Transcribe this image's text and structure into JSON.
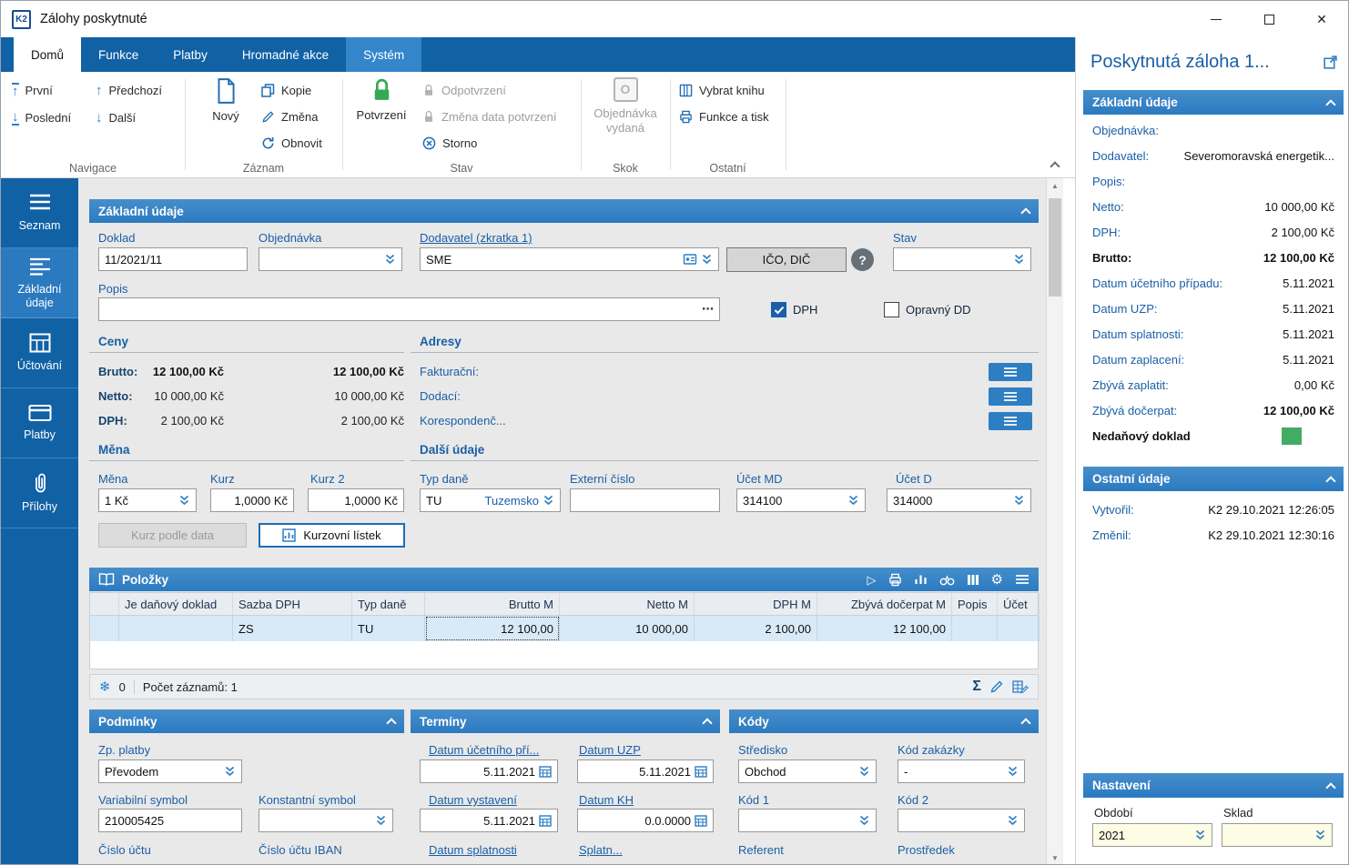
{
  "icons": {
    "close": "✕",
    "more": "⋯",
    "help": "?",
    "arrow_up": "↑",
    "arrow_down": "↓",
    "order_letter": "O",
    "play": "▷",
    "gear": "⚙",
    "snowflake": "❄",
    "sigma": "Σ",
    "scroll_up": "▲",
    "scroll_down": "▼"
  },
  "window": {
    "title": "Zálohy poskytnuté",
    "logo": "K2"
  },
  "ribbon": {
    "tabs": [
      "Domů",
      "Funkce",
      "Platby",
      "Hromadné akce",
      "Systém"
    ],
    "navigace": {
      "group": "Navigace",
      "first": "První",
      "previous": "Předchozí",
      "last": "Poslední",
      "next": "Další"
    },
    "zaznam": {
      "group": "Záznam",
      "new": "Nový",
      "copy": "Kopie",
      "change": "Změna",
      "refresh": "Obnovit"
    },
    "stav": {
      "group": "Stav",
      "confirm": "Potvrzení",
      "unconfirm": "Odpotvrzení",
      "change_confirm_date": "Změna data potvrzení",
      "cancel": "Storno"
    },
    "skok": {
      "group": "Skok",
      "order_issued": "Objednávka vydaná"
    },
    "ostatni": {
      "group": "Ostatní",
      "select_book": "Vybrat knihu",
      "functions_print": "Funkce a tisk"
    }
  },
  "sidebar": {
    "items": [
      "Seznam",
      "Základní údaje",
      "Účtování",
      "Platby",
      "Přílohy"
    ]
  },
  "form": {
    "section_title": "Základní údaje",
    "doklad": {
      "label": "Doklad",
      "value": "11/2021/11"
    },
    "objednavka": {
      "label": "Objednávka",
      "value": ""
    },
    "dodavatel": {
      "label": "Dodavatel (zkratka 1)",
      "value": "SME"
    },
    "ico_dic_button": "IČO, DIČ",
    "stav": {
      "label": "Stav",
      "value": ""
    },
    "popis": {
      "label": "Popis",
      "value": ""
    },
    "dph_checkbox": "DPH",
    "opravny_dd_checkbox": "Opravný DD",
    "ceny": {
      "title": "Ceny",
      "rows": [
        {
          "label": "Brutto:",
          "value1": "12 100,00 Kč",
          "value2": "12 100,00 Kč"
        },
        {
          "label": "Netto:",
          "value1": "10 000,00 Kč",
          "value2": "10 000,00 Kč"
        },
        {
          "label": "DPH:",
          "value1": "2 100,00 Kč",
          "value2": "2 100,00 Kč"
        }
      ]
    },
    "adresy": {
      "title": "Adresy",
      "rows": [
        "Fakturační:",
        "Dodací:",
        "Korespondenč..."
      ]
    },
    "mena": {
      "title": "Měna",
      "mena": {
        "label": "Měna",
        "value": "1 Kč"
      },
      "kurz": {
        "label": "Kurz",
        "value": "1,0000 Kč"
      },
      "kurz2": {
        "label": "Kurz 2",
        "value": "1,0000 Kč"
      }
    },
    "dalsi_udaje": {
      "title": "Další údaje",
      "typ_dane": {
        "label": "Typ daně",
        "code": "TU",
        "value": "Tuzemsko"
      },
      "externi_cislo": {
        "label": "Externí číslo",
        "value": ""
      },
      "ucet_md": {
        "label": "Účet MD",
        "value": "314100"
      },
      "ucet_d": {
        "label": "Účet D",
        "value": "314000"
      }
    },
    "kurz_podle_data_button": "Kurz podle data",
    "kurzovni_listek_button": "Kurzovní lístek"
  },
  "polozky": {
    "title": "Položky",
    "columns": [
      "Je daňový doklad",
      "Sazba DPH",
      "Typ daně",
      "Brutto M",
      "Netto M",
      "DPH M",
      "Zbývá dočerpat M",
      "Popis",
      "Účet"
    ],
    "row": {
      "je_danovy": "",
      "sazba_dph": "ZS",
      "typ_dane": "TU",
      "brutto_m": "12 100,00",
      "netto_m": "10 000,00",
      "dph_m": "2 100,00",
      "zbyva_docerpat_m": "12 100,00",
      "popis": "",
      "ucet": ""
    },
    "frozen": "0",
    "count": "Počet záznamů: 1"
  },
  "podminky": {
    "title": "Podmínky",
    "zp_platby": {
      "label": "Zp. platby",
      "value": "Převodem"
    },
    "variabilni_symbol": {
      "label": "Variabilní symbol",
      "value": "210005425"
    },
    "konstantni_symbol": {
      "label": "Konstantní symbol",
      "value": ""
    },
    "cislo_uctu": "Číslo účtu",
    "cislo_uctu_iban": "Číslo účtu IBAN"
  },
  "terminy": {
    "title": "Termíny",
    "datum_ucetniho": {
      "label": "Datum účetního pří...",
      "value": "5.11.2021"
    },
    "datum_uzp": {
      "label": "Datum UZP",
      "value": "5.11.2021"
    },
    "datum_vystaveni": {
      "label": "Datum vystavení",
      "value": "5.11.2021"
    },
    "datum_kh": {
      "label": "Datum KH",
      "value": "0.0.0000"
    },
    "datum_splatnosti": "Datum splatnosti",
    "splatn": "Splatn..."
  },
  "kody": {
    "title": "Kódy",
    "stredisko": {
      "label": "Středisko",
      "value": "Obchod"
    },
    "kod_zakazky": {
      "label": "Kód zakázky",
      "value": "-"
    },
    "kod1": {
      "label": "Kód 1",
      "value": ""
    },
    "kod2": {
      "label": "Kód 2",
      "value": ""
    },
    "referent": "Referent",
    "prostredek": "Prostředek"
  },
  "right_panel": {
    "title": "Poskytnutá záloha 1...",
    "zakladni_udaje": {
      "title": "Základní údaje",
      "rows": [
        {
          "label": "Objednávka:",
          "value": ""
        },
        {
          "label": "Dodavatel:",
          "value": "Severomoravská energetik..."
        },
        {
          "label": "Popis:",
          "value": ""
        },
        {
          "label": "Netto:",
          "value": "10 000,00 Kč"
        },
        {
          "label": "DPH:",
          "value": "2 100,00 Kč"
        },
        {
          "label": "Brutto:",
          "value": "12 100,00 Kč"
        },
        {
          "label": "Datum účetního případu:",
          "value": "5.11.2021"
        },
        {
          "label": "Datum UZP:",
          "value": "5.11.2021"
        },
        {
          "label": "Datum splatnosti:",
          "value": "5.11.2021"
        },
        {
          "label": "Datum zaplacení:",
          "value": "5.11.2021"
        },
        {
          "label": "Zbývá zaplatit:",
          "value": "0,00 Kč"
        },
        {
          "label": "Zbývá dočerpat:",
          "value": "12 100,00 Kč"
        },
        {
          "label": "Nedaňový doklad",
          "value": ""
        }
      ]
    },
    "ostatni_udaje": {
      "title": "Ostatní údaje",
      "rows": [
        {
          "label": "Vytvořil:",
          "value": "K2 29.10.2021 12:26:05"
        },
        {
          "label": "Změnil:",
          "value": "K2 29.10.2021 12:30:16"
        }
      ]
    },
    "nastaveni": {
      "title": "Nastavení",
      "obdobi": {
        "label": "Období",
        "value": "2021"
      },
      "sklad": {
        "label": "Sklad",
        "value": ""
      }
    }
  }
}
